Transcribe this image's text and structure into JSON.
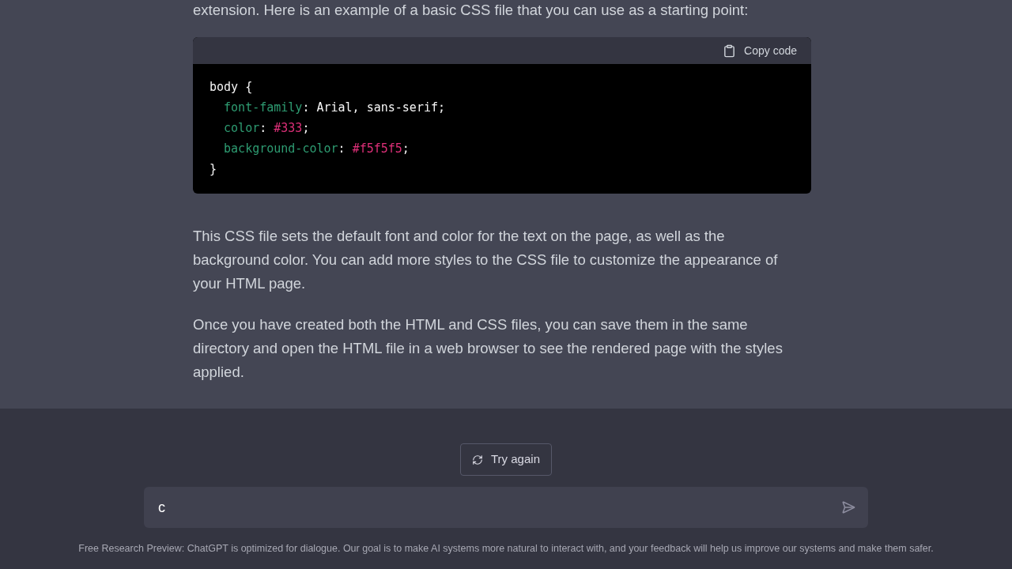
{
  "message": {
    "intro": "extension. Here is an example of a basic CSS file that you can use as a starting point:",
    "code_block": {
      "copy_label": "Copy code",
      "lines": [
        [
          {
            "kind": "plain",
            "text": "body {"
          }
        ],
        [
          {
            "kind": "property",
            "text": "  font-family"
          },
          {
            "kind": "plain",
            "text": ": Arial, sans-serif;"
          }
        ],
        [
          {
            "kind": "property",
            "text": "  color"
          },
          {
            "kind": "plain",
            "text": ": "
          },
          {
            "kind": "value",
            "text": "#333"
          },
          {
            "kind": "plain",
            "text": ";"
          }
        ],
        [
          {
            "kind": "property",
            "text": "  background-color"
          },
          {
            "kind": "plain",
            "text": ": "
          },
          {
            "kind": "value",
            "text": "#f5f5f5"
          },
          {
            "kind": "plain",
            "text": ";"
          }
        ],
        [
          {
            "kind": "plain",
            "text": "}"
          }
        ]
      ]
    },
    "paragraphs": [
      "This CSS file sets the default font and color for the text on the page, as well as the background color. You can add more styles to the CSS file to customize the appearance of your HTML page.",
      "Once you have created both the HTML and CSS files, you can save them in the same directory and open the HTML file in a web browser to see the rendered page with the styles applied."
    ]
  },
  "try_again_button": "Try again",
  "composer": {
    "value": "c"
  },
  "footer": "Free Research Preview: ChatGPT is optimized for dialogue. Our goal is to make AI systems more natural to interact with, and your feedback will help us improve our systems and make them safer."
}
